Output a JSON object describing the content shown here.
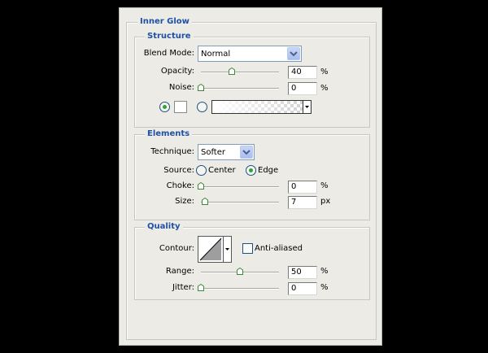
{
  "panel": {
    "title": "Inner Glow",
    "structure": {
      "legend": "Structure",
      "blend_mode": {
        "label": "Blend Mode:",
        "value": "Normal"
      },
      "opacity": {
        "label": "Opacity:",
        "value": "40",
        "unit": "%",
        "slider_fraction": 0.4
      },
      "noise": {
        "label": "Noise:",
        "value": "0",
        "unit": "%",
        "slider_fraction": 0.0
      },
      "source_type": {
        "selected": "color",
        "color": "#ffffff"
      }
    },
    "elements": {
      "legend": "Elements",
      "technique": {
        "label": "Technique:",
        "value": "Softer"
      },
      "source": {
        "label": "Source:",
        "options": [
          "Center",
          "Edge"
        ],
        "selected": "Edge"
      },
      "choke": {
        "label": "Choke:",
        "value": "0",
        "unit": "%",
        "slider_fraction": 0.0
      },
      "size": {
        "label": "Size:",
        "value": "7",
        "unit": "px",
        "slider_fraction": 0.05
      }
    },
    "quality": {
      "legend": "Quality",
      "contour": {
        "label": "Contour:"
      },
      "anti_aliased": {
        "label": "Anti-aliased",
        "checked": false
      },
      "range": {
        "label": "Range:",
        "value": "50",
        "unit": "%",
        "slider_fraction": 0.5
      },
      "jitter": {
        "label": "Jitter:",
        "value": "0",
        "unit": "%",
        "slider_fraction": 0.0
      }
    }
  },
  "colors": {
    "legend_blue": "#1f50a6",
    "radio_green": "#2fa13f",
    "panel_bg": "#ecebe6",
    "background": "#000000"
  },
  "icons": {
    "dropdown": "chevron-down-icon",
    "slider_thumb": "slider-thumb-icon",
    "contour_preview": "contour-curve-icon"
  }
}
